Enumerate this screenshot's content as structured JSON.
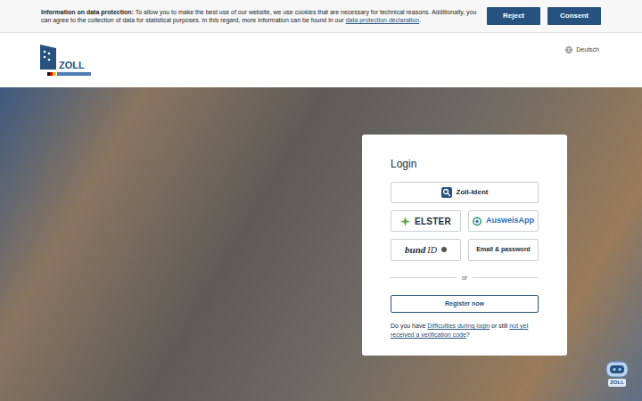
{
  "cookie_banner": {
    "title": "Information on data protection:",
    "text": "To allow you to make the best use of our website, we use cookies that are necessary for technical reasons. Additionally, you can agree to the collection of data for statistical purposes. In this regard, more information can be found in our",
    "link": "data protection declaration",
    "end": ".",
    "buttons": [
      "Reject",
      "Consent"
    ]
  },
  "header": {
    "logo": "ZOLL",
    "language": "Deutsch"
  },
  "login": {
    "title": "Login",
    "providers": [
      {
        "label": "Zoll-Ident",
        "label2": "",
        "kind": "zoll"
      },
      {
        "label": "ELSTER",
        "label2": "",
        "kind": "elster"
      },
      {
        "label": "AusweisApp",
        "label2": "",
        "kind": "ausweis"
      },
      {
        "label": "bund",
        "label2": "ID",
        "kind": "bund"
      },
      {
        "label": "Email & password",
        "label2": "",
        "kind": "email"
      }
    ],
    "divider": "or",
    "register": "Register now",
    "help": {
      "prefix": "Do you have ",
      "link1": "Difficulties during login",
      "middle": " or still ",
      "link2": "not yet received a verification code",
      "suffix": "?"
    }
  },
  "chatbot": {
    "label": "ZOLL"
  }
}
